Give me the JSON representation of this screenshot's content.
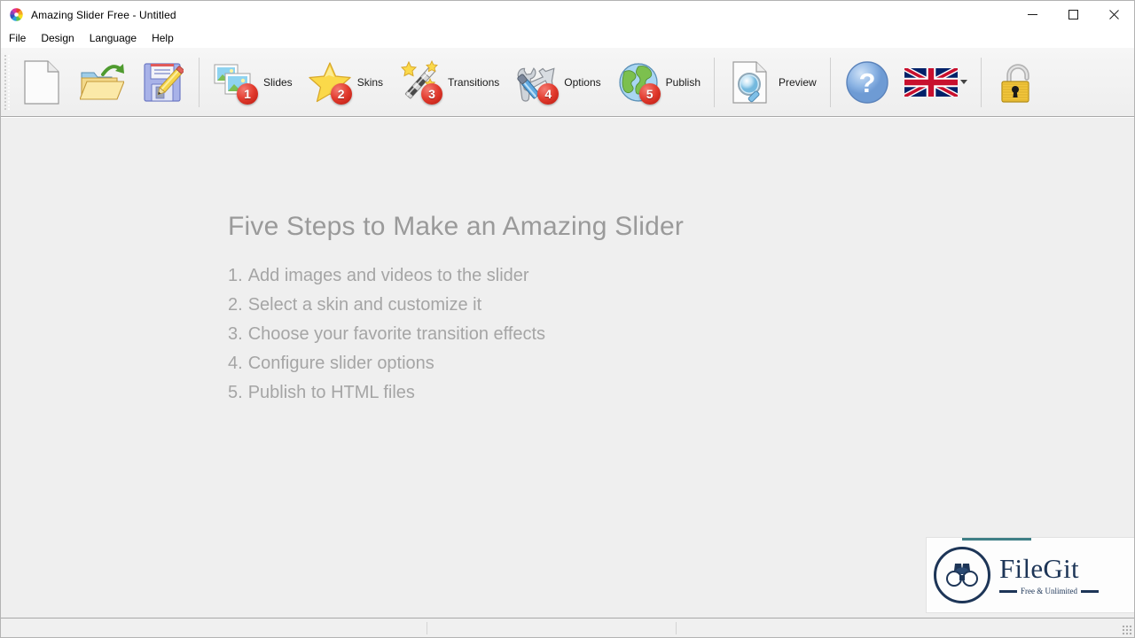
{
  "window": {
    "app_icon": "amazing-slider-logo-icon",
    "title": "Amazing Slider Free - Untitled",
    "minimize_label": "—",
    "maximize_label": "□",
    "close_label": "✕"
  },
  "menubar": {
    "items": [
      {
        "label": "File"
      },
      {
        "label": "Design"
      },
      {
        "label": "Language"
      },
      {
        "label": "Help"
      }
    ]
  },
  "toolbar": {
    "groups": [
      {
        "name": "file-group",
        "buttons": [
          {
            "name": "new-button",
            "icon": "new-document-icon",
            "label": "",
            "badge": ""
          },
          {
            "name": "open-button",
            "icon": "open-folder-icon",
            "label": "",
            "badge": ""
          },
          {
            "name": "save-button",
            "icon": "floppy-disk-pencil-icon",
            "label": "",
            "badge": ""
          }
        ]
      },
      {
        "name": "steps-group",
        "buttons": [
          {
            "name": "slides-button",
            "icon": "photos-stack-icon",
            "label": "Slides",
            "badge": "1"
          },
          {
            "name": "skins-button",
            "icon": "star-icon",
            "label": "Skins",
            "badge": "2"
          },
          {
            "name": "transitions-button",
            "icon": "magic-wand-icon",
            "label": "Transitions",
            "badge": "3"
          },
          {
            "name": "options-button",
            "icon": "tools-icon",
            "label": "Options",
            "badge": "4"
          },
          {
            "name": "publish-button",
            "icon": "globe-icon",
            "label": "Publish",
            "badge": "5"
          }
        ]
      },
      {
        "name": "preview-group",
        "buttons": [
          {
            "name": "preview-button",
            "icon": "page-magnifier-icon",
            "label": "Preview",
            "badge": ""
          }
        ]
      },
      {
        "name": "help-group",
        "buttons": [
          {
            "name": "help-button",
            "icon": "question-mark-icon",
            "label": "",
            "badge": ""
          },
          {
            "name": "language-button",
            "icon": "uk-flag-icon",
            "label": "",
            "badge": ""
          }
        ]
      },
      {
        "name": "license-group",
        "buttons": [
          {
            "name": "unlock-button",
            "icon": "open-padlock-icon",
            "label": "",
            "badge": ""
          }
        ]
      }
    ]
  },
  "main": {
    "heading": "Five Steps to Make an Amazing Slider",
    "steps": [
      {
        "num": "1.",
        "text": "Add images and videos to the slider"
      },
      {
        "num": "2.",
        "text": "Select a skin and customize it"
      },
      {
        "num": "3.",
        "text": "Choose your favorite transition effects"
      },
      {
        "num": "4.",
        "text": "Configure slider options"
      },
      {
        "num": "5.",
        "text": "Publish to HTML files"
      }
    ]
  },
  "watermark": {
    "name": "FileGit",
    "tagline": "Free & Unlimited",
    "icon": "binoculars-in-circle-icon"
  },
  "statusbar": {
    "cell1": "",
    "cell2": "",
    "cell3": ""
  },
  "colors": {
    "badge_red": "#e23b2e",
    "content_bg": "#efefef",
    "text_gray": "#a5a5a5",
    "heading_gray": "#9a9a9a",
    "watermark_navy": "#1d3557"
  }
}
